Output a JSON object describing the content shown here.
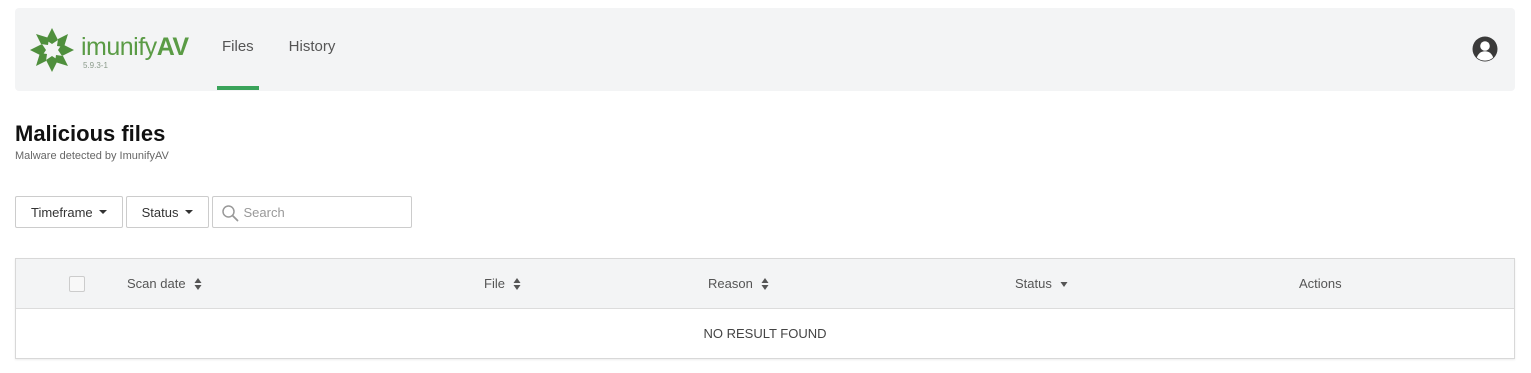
{
  "app": {
    "name_light": "imunify",
    "name_bold": "AV",
    "version": "5.9.3-1"
  },
  "nav": {
    "tabs": [
      {
        "label": "Files",
        "active": true
      },
      {
        "label": "History",
        "active": false
      }
    ]
  },
  "header": {
    "title": "Malicious files",
    "subtitle": "Malware detected by ImunifyAV"
  },
  "filters": {
    "timeframe_label": "Timeframe",
    "status_label": "Status",
    "search_placeholder": "Search",
    "search_value": ""
  },
  "table": {
    "columns": [
      "Scan date",
      "File",
      "Reason",
      "Status",
      "Actions"
    ],
    "empty_message": "NO RESULT FOUND"
  },
  "colors": {
    "brand_green": "#5a9b45",
    "active_tab_underline": "#3aa35a",
    "header_bg": "#f3f4f5"
  },
  "icons": {
    "logo": "imunify-star-logo",
    "avatar": "user-avatar-icon",
    "search": "search-icon",
    "sort": "sort-icon",
    "status_sort": "caret-down-icon"
  }
}
